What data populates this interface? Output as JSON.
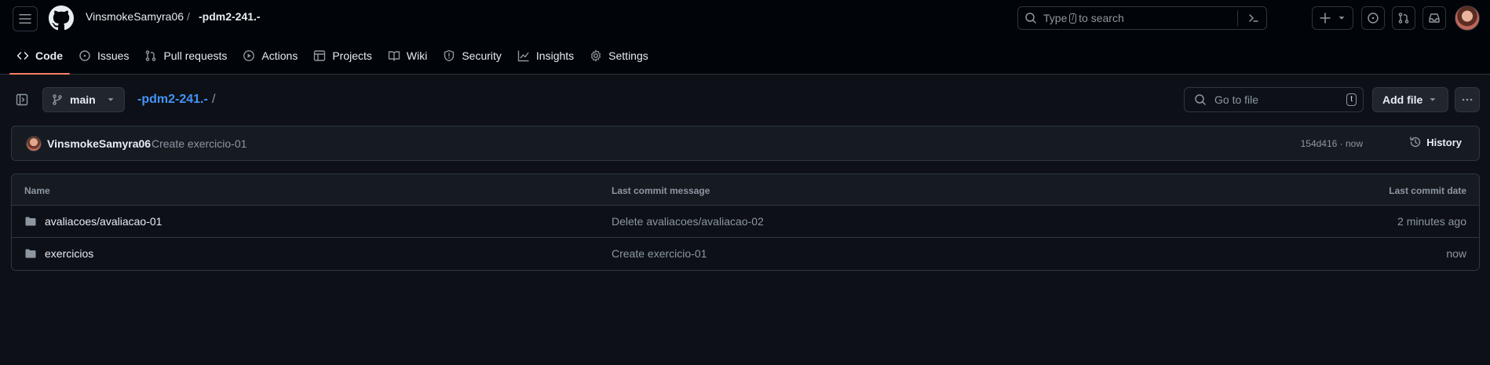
{
  "header": {
    "owner": "VinsmokeSamyra06",
    "separator": "/",
    "repo": "-pdm2-241.-",
    "search": {
      "prefix": "Type",
      "key": "/",
      "suffix": "to search"
    }
  },
  "tabs": [
    {
      "label": "Code",
      "icon": "code-icon",
      "active": true
    },
    {
      "label": "Issues",
      "icon": "issue-icon"
    },
    {
      "label": "Pull requests",
      "icon": "pull-request-icon"
    },
    {
      "label": "Actions",
      "icon": "play-icon"
    },
    {
      "label": "Projects",
      "icon": "table-icon"
    },
    {
      "label": "Wiki",
      "icon": "book-icon"
    },
    {
      "label": "Security",
      "icon": "shield-icon"
    },
    {
      "label": "Insights",
      "icon": "graph-icon"
    },
    {
      "label": "Settings",
      "icon": "gear-icon"
    }
  ],
  "toolbar": {
    "branch": "main",
    "path_repo": "-pdm2-241.-",
    "path_sep": "/",
    "goto_placeholder": "Go to file",
    "goto_key": "t",
    "add_file": "Add file"
  },
  "commit": {
    "author": "VinsmokeSamyra06",
    "message": "Create exercicio-01",
    "meta": "154d416 · now",
    "history": "History"
  },
  "files": {
    "columns": [
      "Name",
      "Last commit message",
      "Last commit date"
    ],
    "rows": [
      {
        "name": "avaliacoes/avaliacao-01",
        "message": "Delete avaliacoes/avaliacao-02",
        "date": "2 minutes ago"
      },
      {
        "name": "exercicios",
        "message": "Create exercicio-01",
        "date": "now"
      }
    ]
  },
  "colors": {
    "background": "#0d1117",
    "header_bg": "#010409",
    "accent_link": "#4493f8",
    "tab_underline": "#f78166"
  }
}
